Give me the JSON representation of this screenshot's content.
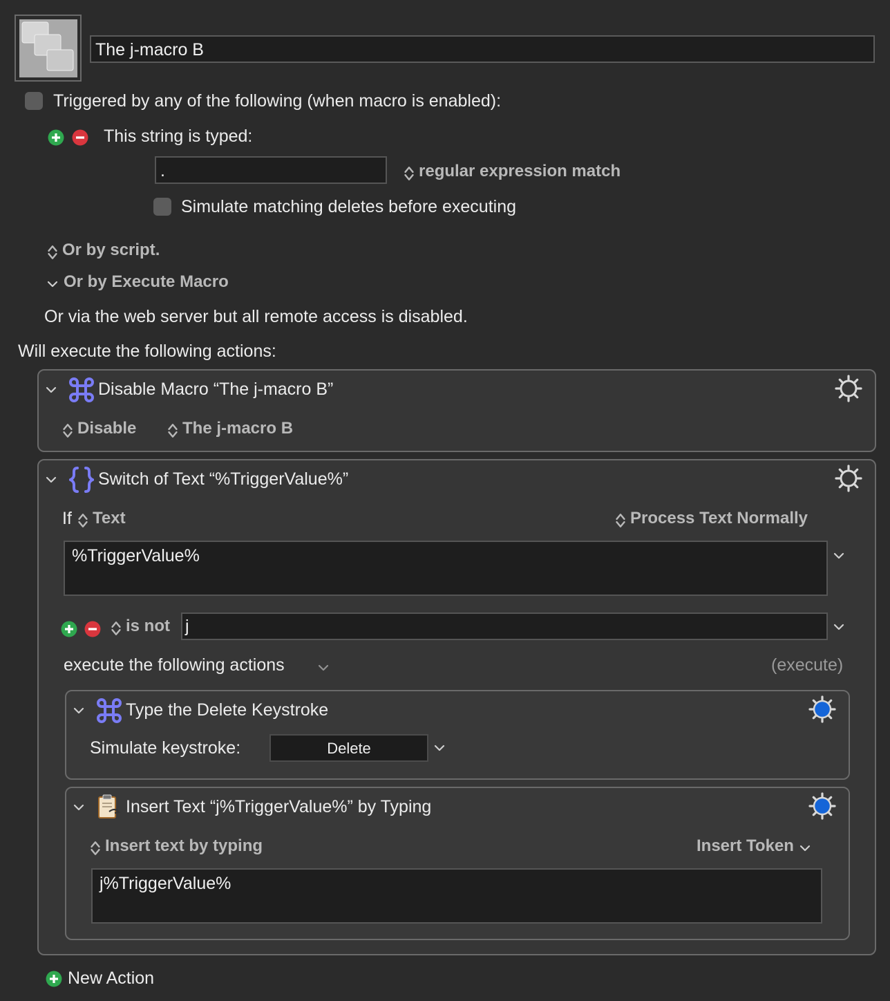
{
  "macro": {
    "name": "The j-macro B"
  },
  "triggers": {
    "heading": "Triggered by any of the following (when macro is enabled):",
    "string_typed_label": "This string is typed:",
    "typed_string_value": ".",
    "match_mode": "regular expression match",
    "simulate_deletes_label": "Simulate matching deletes before executing",
    "or_by_script": "Or by script.",
    "or_by_execute_macro": "Or by Execute Macro",
    "web_server_note": "Or via the web server but all remote access is disabled."
  },
  "actions_heading": "Will execute the following actions:",
  "action1": {
    "title": "Disable Macro “The j-macro B”",
    "mode": "Disable",
    "target": "The j-macro B"
  },
  "action2": {
    "title": "Switch of Text “%TriggerValue%”",
    "if_label": "If",
    "source": "Text",
    "processing": "Process Text Normally",
    "text_value": "%TriggerValue%",
    "case_condition": "is not",
    "case_value": "j",
    "execute_label": "execute the following actions",
    "execute_right": "(execute)"
  },
  "action3": {
    "title": "Type the Delete Keystroke",
    "simulate_label": "Simulate keystroke:",
    "key": "Delete"
  },
  "action4": {
    "title": "Insert Text “j%TriggerValue%” by Typing",
    "mode": "Insert text by typing",
    "insert_token": "Insert Token",
    "text_value": "j%TriggerValue%"
  },
  "new_action_label": "New Action",
  "colors": {
    "background": "#2b2b2b",
    "command_icon": "#7a7cf5",
    "add_green": "#2fa84f",
    "remove_red": "#d9363e",
    "gear_active_blue": "#1565d8"
  },
  "icons": [
    "macro-icon",
    "checkbox",
    "add-icon",
    "remove-icon",
    "updown-icon",
    "chevron-down-icon",
    "command-icon",
    "braces-icon",
    "gear-icon",
    "clipboard-icon"
  ]
}
